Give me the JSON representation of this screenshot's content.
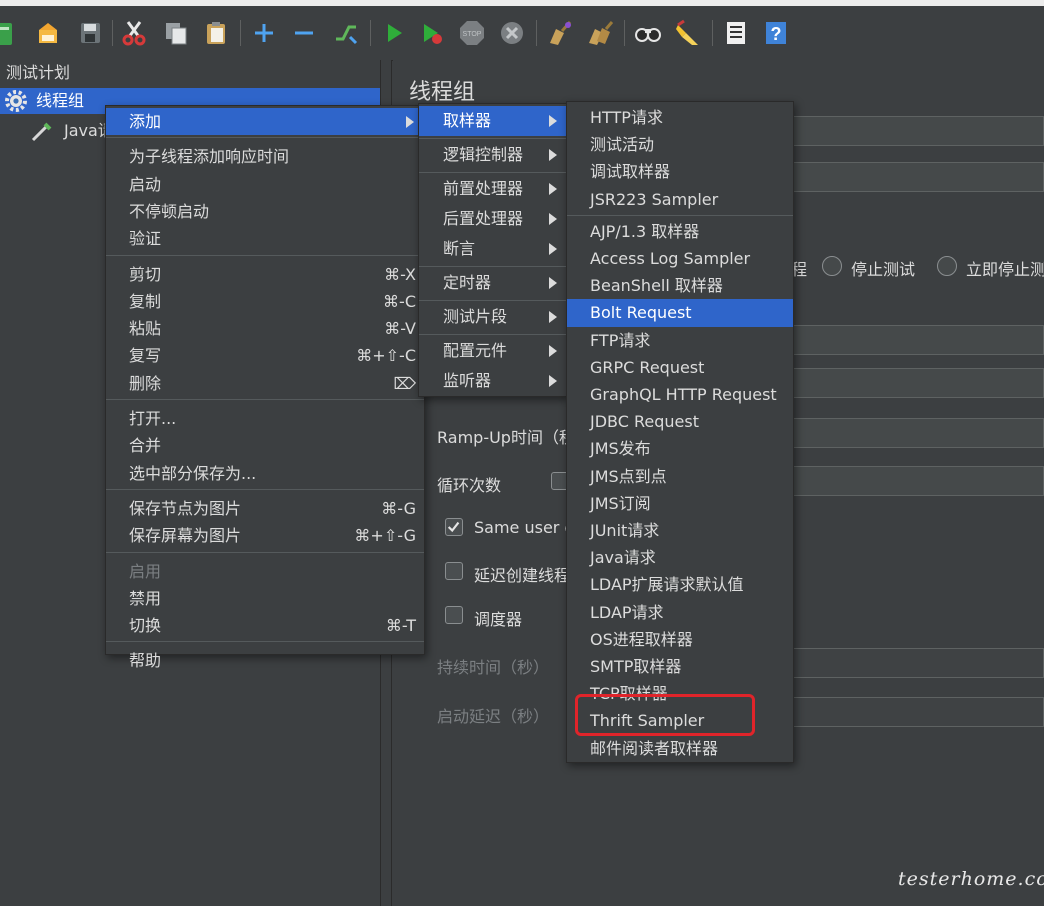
{
  "toolbar": {
    "icons": [
      "new-icon",
      "templates-icon",
      "open-icon",
      "save-icon",
      "cut-icon",
      "copy-icon",
      "paste-icon",
      "expand-icon",
      "collapse-icon",
      "toggle-icon",
      "start-icon",
      "start-no-pause-icon",
      "stop-icon",
      "shutdown-icon",
      "clear-icon",
      "clear-all-icon",
      "search-icon",
      "reset-search-icon",
      "function-helper-icon",
      "help-icon"
    ]
  },
  "tree": {
    "root": "测试计划",
    "thread_group": "线程组",
    "child": "Java请求"
  },
  "panel": {
    "title": "线程组",
    "radio_stop_thread_suffix": "程",
    "radio_stop_test": "停止测试",
    "radio_stop_now": "立即停止测",
    "rampup": "Ramp-Up时间（秒）：",
    "loop_count": "循环次数",
    "same_user": "Same user on each iteration",
    "delay_create": "延迟创建线程直到需要",
    "scheduler": "调度器",
    "duration": "持续时间（秒）",
    "startup_delay": "启动延迟（秒）"
  },
  "context_menu": {
    "items": [
      {
        "label": "添加",
        "submenu": true,
        "selected": true
      },
      {
        "separator": true
      },
      {
        "label": "为子线程添加响应时间"
      },
      {
        "label": "启动"
      },
      {
        "label": "不停顿启动"
      },
      {
        "label": "验证"
      },
      {
        "separator": true
      },
      {
        "label": "剪切",
        "shortcut": "⌘-X"
      },
      {
        "label": "复制",
        "shortcut": "⌘-C"
      },
      {
        "label": "粘贴",
        "shortcut": "⌘-V"
      },
      {
        "label": "复写",
        "shortcut": "⌘+⇧-C"
      },
      {
        "label": "删除",
        "shortcut": "⌦"
      },
      {
        "separator": true
      },
      {
        "label": "打开..."
      },
      {
        "label": "合并"
      },
      {
        "label": "选中部分保存为..."
      },
      {
        "separator": true
      },
      {
        "label": "保存节点为图片",
        "shortcut": "⌘-G"
      },
      {
        "label": "保存屏幕为图片",
        "shortcut": "⌘+⇧-G"
      },
      {
        "separator": true
      },
      {
        "label": "启用",
        "disabled": true
      },
      {
        "label": "禁用"
      },
      {
        "label": "切换",
        "shortcut": "⌘-T"
      },
      {
        "separator": true
      },
      {
        "label": "帮助"
      }
    ]
  },
  "add_submenu": {
    "items": [
      {
        "label": "取样器",
        "submenu": true,
        "selected": true
      },
      {
        "separator": true
      },
      {
        "label": "逻辑控制器",
        "submenu": true
      },
      {
        "separator": true
      },
      {
        "label": "前置处理器",
        "submenu": true
      },
      {
        "label": "后置处理器",
        "submenu": true
      },
      {
        "label": "断言",
        "submenu": true
      },
      {
        "separator": true
      },
      {
        "label": "定时器",
        "submenu": true
      },
      {
        "separator": true
      },
      {
        "label": "测试片段",
        "submenu": true
      },
      {
        "separator": true
      },
      {
        "label": "配置元件",
        "submenu": true
      },
      {
        "label": "监听器",
        "submenu": true
      }
    ]
  },
  "sampler_submenu": {
    "items": [
      {
        "label": "HTTP请求"
      },
      {
        "label": "测试活动"
      },
      {
        "label": "调试取样器"
      },
      {
        "label": "JSR223 Sampler"
      },
      {
        "separator": true
      },
      {
        "label": "AJP/1.3 取样器"
      },
      {
        "label": "Access Log Sampler"
      },
      {
        "label": "BeanShell 取样器"
      },
      {
        "label": "Bolt Request",
        "selected": true
      },
      {
        "label": "FTP请求"
      },
      {
        "label": "GRPC Request"
      },
      {
        "label": "GraphQL HTTP Request"
      },
      {
        "label": "JDBC Request"
      },
      {
        "label": "JMS发布"
      },
      {
        "label": "JMS点到点"
      },
      {
        "label": "JMS订阅"
      },
      {
        "label": "JUnit请求"
      },
      {
        "label": "Java请求"
      },
      {
        "label": "LDAP扩展请求默认值"
      },
      {
        "label": "LDAP请求"
      },
      {
        "label": "OS进程取样器"
      },
      {
        "label": "SMTP取样器"
      },
      {
        "label": "TCP取样器"
      },
      {
        "label": "Thrift Sampler"
      },
      {
        "label": "邮件阅读者取样器"
      }
    ]
  },
  "watermark": "testerhome.com",
  "colors": {
    "background": "#3c3f41",
    "selection": "#2f65ca",
    "highlight_box": "#e0242a"
  }
}
